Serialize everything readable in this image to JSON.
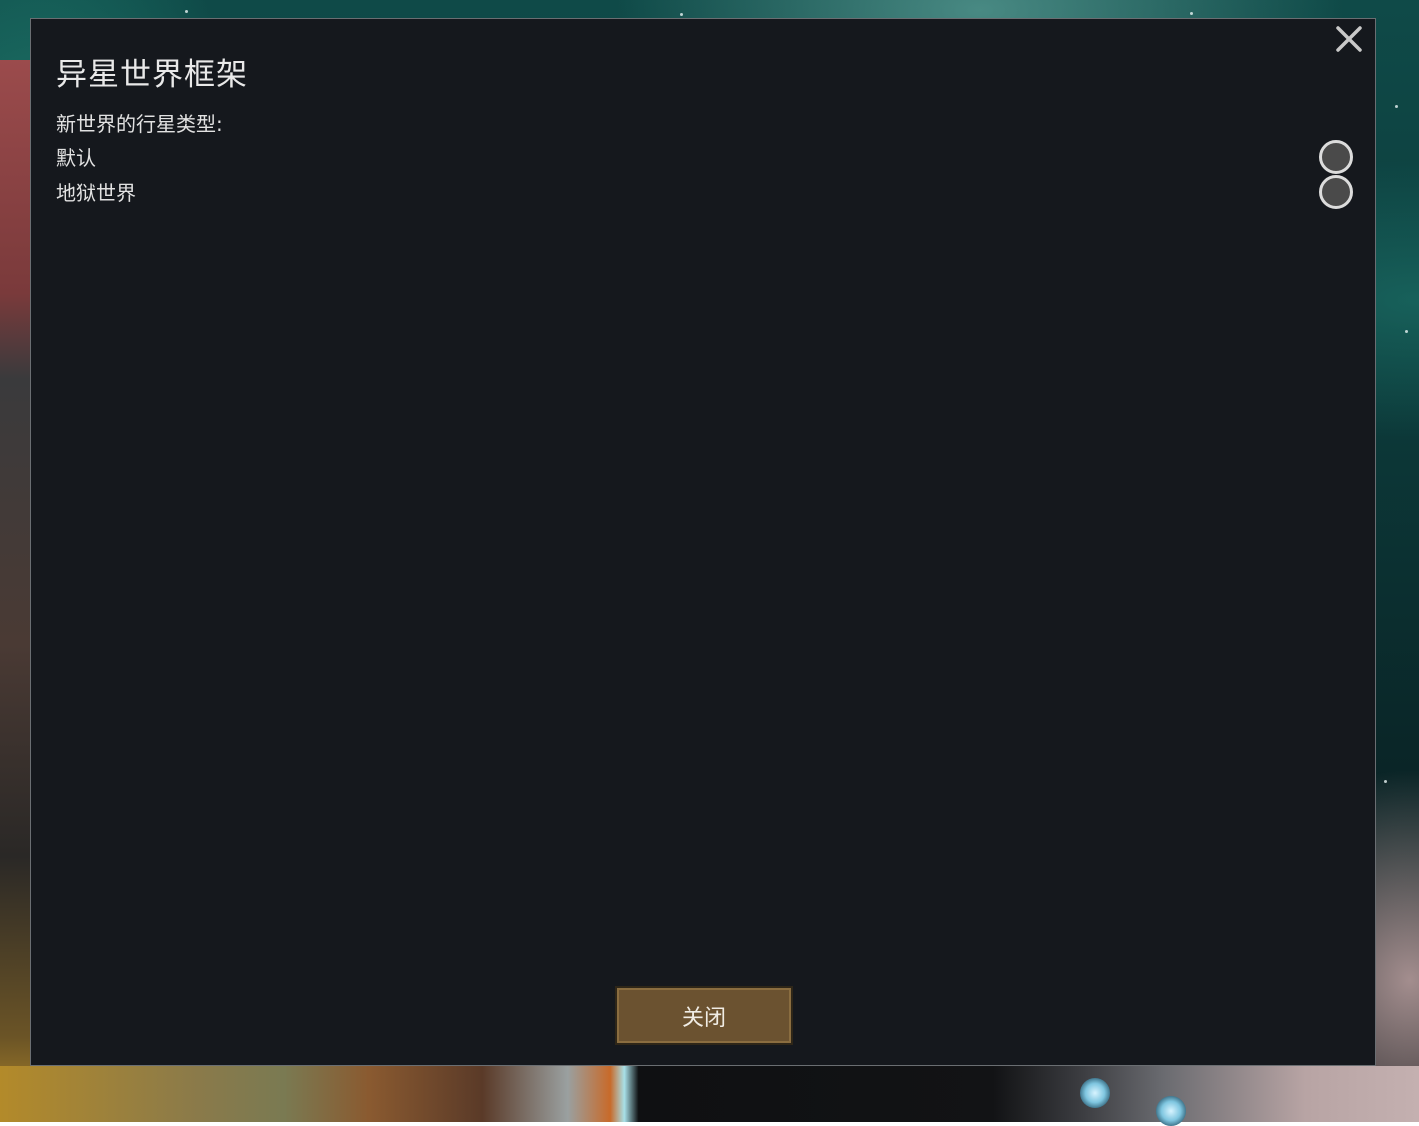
{
  "dialog": {
    "title": "异星世界框架",
    "close_icon": "close-x-icon",
    "subtitle": "新世界的行星类型:",
    "options": [
      {
        "label": "默认",
        "selected": false
      },
      {
        "label": "地狱世界",
        "selected": false
      }
    ],
    "close_button_label": "关闭"
  },
  "colors": {
    "dialog_background": "#15181d",
    "button_background": "#6b5230",
    "text": "#e2e2e2"
  }
}
